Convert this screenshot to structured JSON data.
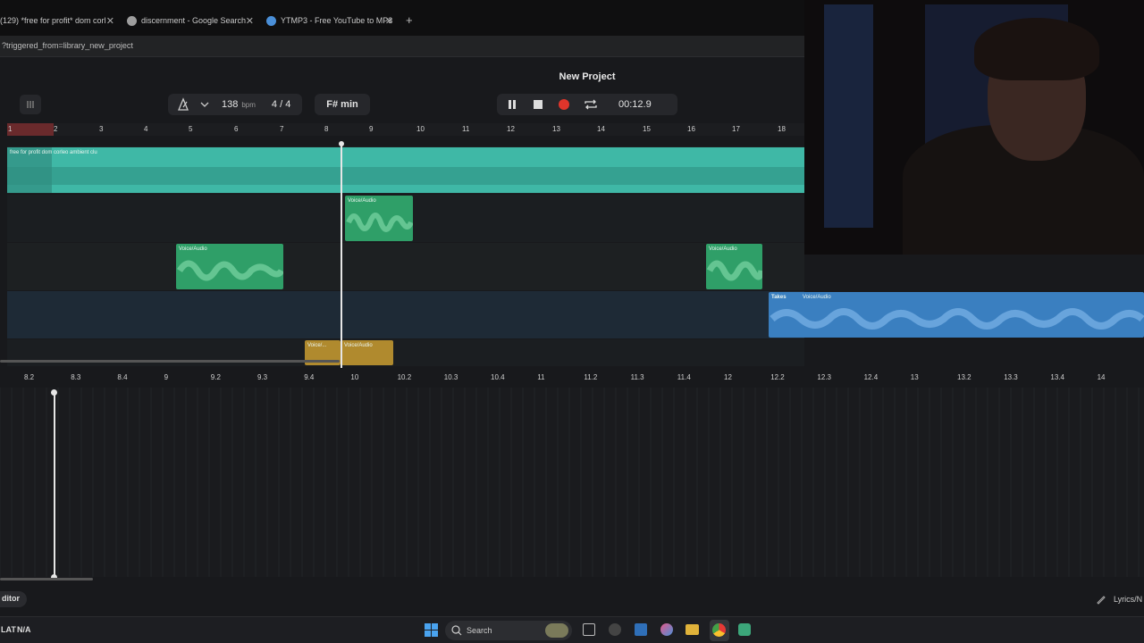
{
  "browser": {
    "tabs": [
      {
        "title": "(129) *free for profit* dom corl",
        "fav": "#e53935"
      },
      {
        "title": "discernment - Google Search",
        "fav": "#9e9e9e"
      },
      {
        "title": "YTMP3 - Free YouTube to MP3",
        "fav": "#4a8fd8"
      }
    ],
    "new_tab_glyph": "+",
    "close_glyph": "✕",
    "url": "?triggered_from=library_new_project"
  },
  "project": {
    "title": "New Project",
    "bpm_value": "138",
    "bpm_unit": "bpm",
    "time_sig": "4 / 4",
    "key": "F# min",
    "time": "00:12.9"
  },
  "timeline": {
    "bars": [
      "1",
      "2",
      "3",
      "4",
      "5",
      "6",
      "7",
      "8",
      "9",
      "10",
      "11",
      "12",
      "13",
      "14",
      "15",
      "16",
      "17",
      "18"
    ]
  },
  "clips": {
    "beat_label": "free for profit dom corleo ambient clu",
    "voice_label": "Voice/Audio",
    "voice_short": "Voice/...",
    "takes_label": "Takes"
  },
  "editor_ruler": [
    "8.2",
    "8.3",
    "8.4",
    "9",
    "9.2",
    "9.3",
    "9.4",
    "10",
    "10.2",
    "10.3",
    "10.4",
    "11",
    "11.2",
    "11.3",
    "11.4",
    "12",
    "12.2",
    "12.3",
    "12.4",
    "13",
    "13.2",
    "13.3",
    "13.4",
    "14"
  ],
  "footer": {
    "editor_label": "ditor",
    "lyrics_label": "Lyrics/N",
    "flat_label": "LAT",
    "flat_value": "N/A"
  },
  "taskbar": {
    "search_label": "Search"
  },
  "colors": {
    "beat": "#3fb8a6",
    "voice": "#2f9f68",
    "takes": "#3a7fc0",
    "clip_yellow": "#b08a2e",
    "record": "#e0352b"
  }
}
